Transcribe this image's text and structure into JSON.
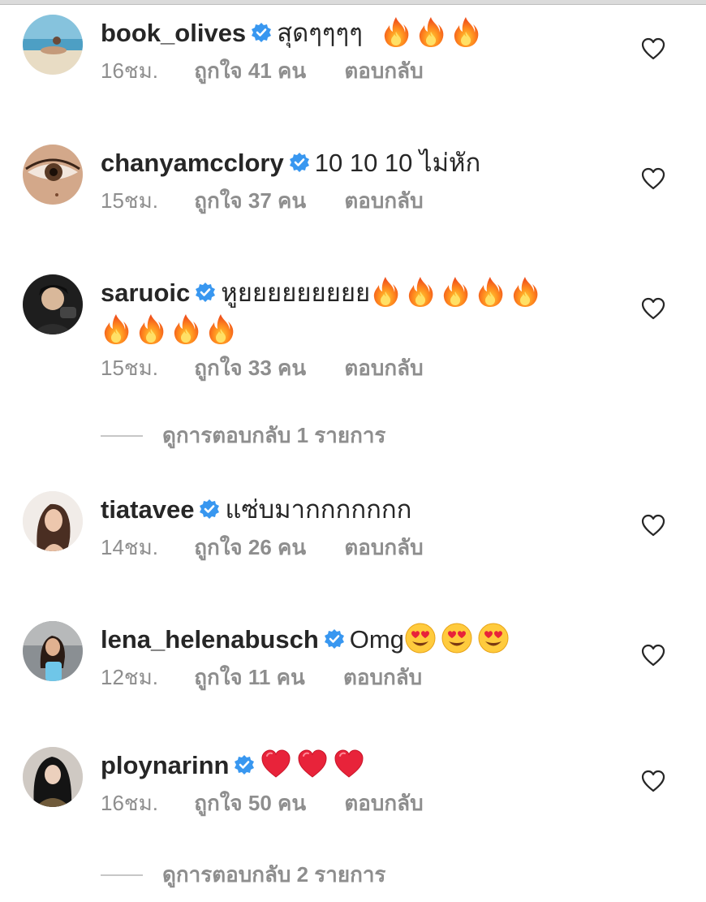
{
  "comments": [
    {
      "username": "book_olives",
      "text": "สุดๆๆๆๆ",
      "emojis": [
        "fire-icon",
        "fire-icon",
        "fire-icon"
      ],
      "time": "16ชม.",
      "likes": "ถูกใจ 41 คน",
      "reply": "ตอบกลับ"
    },
    {
      "username": "chanyamcclory",
      "text": "10 10 10 ไม่หัก",
      "emojis": [],
      "time": "15ชม.",
      "likes": "ถูกใจ 37 คน",
      "reply": "ตอบกลับ"
    },
    {
      "username": "saruoic",
      "text": "หูยยยยยยยยย",
      "emojis": [
        "fire-icon",
        "fire-icon",
        "fire-icon",
        "fire-icon",
        "fire-icon"
      ],
      "emojis_line2": [
        "fire-icon",
        "fire-icon",
        "fire-icon",
        "fire-icon"
      ],
      "time": "15ชม.",
      "likes": "ถูกใจ 33 คน",
      "reply": "ตอบกลับ"
    },
    {
      "username": "tiatavee",
      "text": "แซ่บมากกกกกกก",
      "emojis": [],
      "time": "14ชม.",
      "likes": "ถูกใจ 26 คน",
      "reply": "ตอบกลับ"
    },
    {
      "username": "lena_helenabusch",
      "text": "Omg",
      "emojis": [
        "heart-eyes-emoji-icon",
        "heart-eyes-emoji-icon",
        "heart-eyes-emoji-icon"
      ],
      "time": "12ชม.",
      "likes": "ถูกใจ 11 คน",
      "reply": "ตอบกลับ"
    },
    {
      "username": "ploynarinn",
      "text": "",
      "emojis": [
        "red-heart-icon",
        "red-heart-icon",
        "red-heart-icon"
      ],
      "time": "16ชม.",
      "likes": "ถูกใจ 50 คน",
      "reply": "ตอบกลับ"
    }
  ],
  "view_replies": [
    {
      "label": "ดูการตอบกลับ 1 รายการ"
    },
    {
      "label": "ดูการตอบกลับ 2 รายการ"
    }
  ],
  "colors": {
    "text": "#262626",
    "secondary": "#8e8e8e",
    "verified": "#3897f0",
    "divider": "#dbdbdb"
  }
}
